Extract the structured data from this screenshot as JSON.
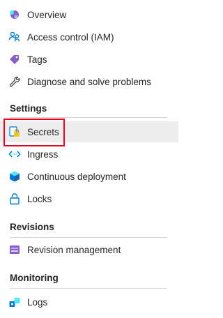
{
  "nav": {
    "top_items": [
      {
        "label": "Overview",
        "icon": "overview-icon"
      },
      {
        "label": "Access control (IAM)",
        "icon": "people-icon"
      },
      {
        "label": "Tags",
        "icon": "tag-icon"
      },
      {
        "label": "Diagnose and solve problems",
        "icon": "wrench-icon"
      }
    ],
    "settings": {
      "title": "Settings",
      "items": [
        {
          "label": "Secrets",
          "icon": "secrets-icon",
          "selected": true
        },
        {
          "label": "Ingress",
          "icon": "ingress-icon"
        },
        {
          "label": "Continuous deployment",
          "icon": "cube-icon"
        },
        {
          "label": "Locks",
          "icon": "lock-icon"
        }
      ]
    },
    "revisions": {
      "title": "Revisions",
      "items": [
        {
          "label": "Revision management",
          "icon": "revision-icon"
        }
      ]
    },
    "monitoring": {
      "title": "Monitoring",
      "items": [
        {
          "label": "Logs",
          "icon": "logs-icon"
        }
      ]
    }
  },
  "colors": {
    "selected_bg": "#ededed",
    "highlight_border": "#e8001c",
    "accent_blue": "#0078d4",
    "accent_purple": "#8661c5"
  }
}
